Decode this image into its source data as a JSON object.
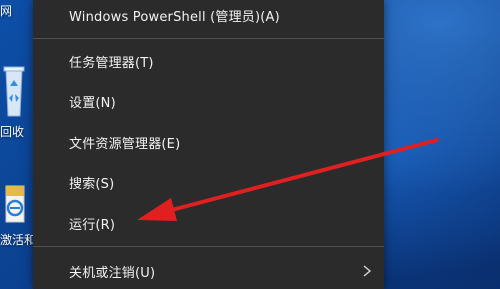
{
  "desktop": {
    "icons": [
      {
        "label": "网",
        "icon": "network-icon"
      },
      {
        "label": "回收",
        "icon": "recycle-bin-icon"
      },
      {
        "label": "激活和",
        "icon": "internet-explorer-icon"
      }
    ]
  },
  "context_menu": {
    "items": [
      {
        "label": "Windows PowerShell (管理员)(A)"
      },
      {
        "label": "任务管理器(T)"
      },
      {
        "label": "设置(N)"
      },
      {
        "label": "文件资源管理器(E)"
      },
      {
        "label": "搜索(S)"
      },
      {
        "label": "运行(R)"
      },
      {
        "label": "关机或注销(U)",
        "submenu_icon": "chevron-right-icon"
      }
    ]
  },
  "annotation": {
    "arrow_color": "#e02020"
  },
  "colors": {
    "menu_background": "#2b2b2b",
    "menu_text": "#f2f2f2",
    "desktop_background": "#0b3f8c"
  }
}
